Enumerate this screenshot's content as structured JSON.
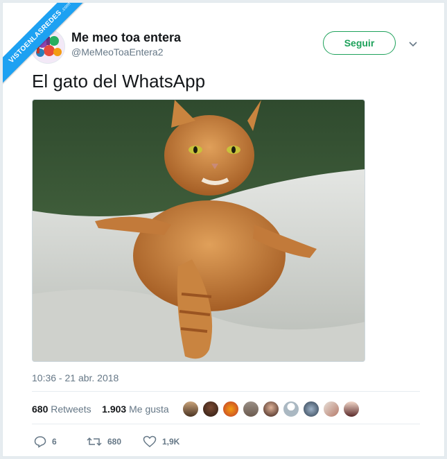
{
  "watermark": {
    "text": "VISTOENLASREDES",
    "suffix": ".com"
  },
  "tweet": {
    "display_name": "Me meo toa entera",
    "handle": "@MeMeoToaEntera2",
    "follow_label": "Seguir",
    "text": "El gato del WhatsApp",
    "timestamp": "10:36 - 21 abr. 2018",
    "retweets_count": "680",
    "retweets_label": "Retweets",
    "likes_count": "1.903",
    "likes_label": "Me gusta"
  },
  "actions": {
    "reply_count": "6",
    "retweet_count": "680",
    "like_count": "1,9K"
  },
  "colors": {
    "follow": "#1da15a",
    "ribbon": "#1da1f2",
    "muted": "#657786"
  }
}
